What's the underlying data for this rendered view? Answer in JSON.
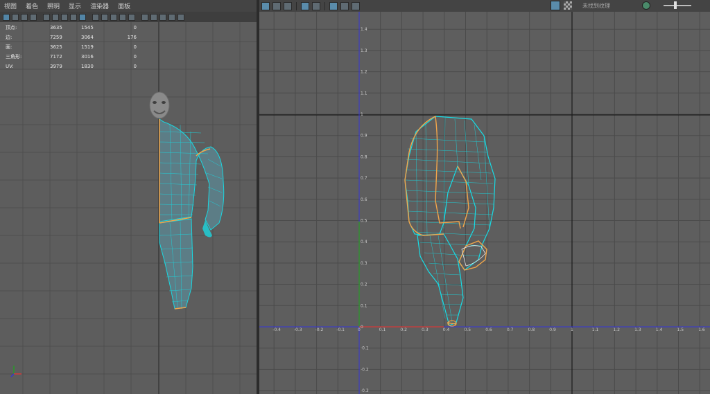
{
  "viewport": {
    "menu": [
      "视图",
      "着色",
      "照明",
      "显示",
      "渲染器",
      "面板"
    ],
    "stats": [
      {
        "label": "顶点:",
        "a": "3635",
        "b": "1545",
        "c": "0"
      },
      {
        "label": "边:",
        "a": "7259",
        "b": "3064",
        "c": "176"
      },
      {
        "label": "面:",
        "a": "3625",
        "b": "1519",
        "c": "0"
      },
      {
        "label": "三角形:",
        "a": "7172",
        "b": "3016",
        "c": "0"
      },
      {
        "label": "UV:",
        "a": "3979",
        "b": "1830",
        "c": "0"
      }
    ]
  },
  "uv_editor": {
    "texture_placeholder": "未找到纹理",
    "x_ticks": [
      "0",
      "-0.4",
      "-0.3",
      "-0.2",
      "-0.1",
      "0",
      "0.1",
      "0.2",
      "0.3",
      "0.4",
      "0.5",
      "0.6",
      "0.7",
      "0.8",
      "0.9",
      "1",
      "1.1",
      "1.2",
      "1.3",
      "1.4",
      "1.5",
      "1.6"
    ],
    "y_ticks": [
      "1.4",
      "1.3",
      "1.2",
      "1.1",
      "1",
      "0.9",
      "0.8",
      "0.7",
      "0.6",
      "0.5",
      "0.4",
      "0.3",
      "0.2",
      "0.1",
      "0",
      "-0.1",
      "-0.2",
      "-0.3"
    ]
  },
  "colors": {
    "wire": "#17dde6",
    "seam": "#f2a64a",
    "grid": "#4b4b4b",
    "axis_x": "#d23a3a",
    "axis_y": "#2a9a2a",
    "axis_blue": "#3535d8"
  }
}
